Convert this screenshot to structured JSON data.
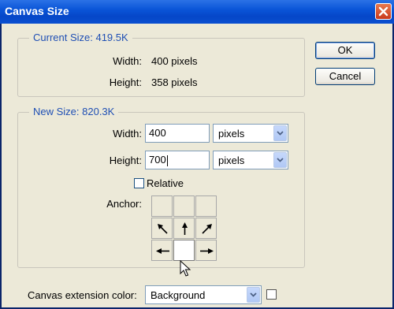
{
  "window": {
    "title": "Canvas Size"
  },
  "current_size": {
    "legend": "Current Size: 419.5K",
    "width_label": "Width:",
    "width_value": "400 pixels",
    "height_label": "Height:",
    "height_value": "358 pixels"
  },
  "new_size": {
    "legend": "New Size: 820.3K",
    "width_label": "Width:",
    "width_value": "400",
    "width_unit": "pixels",
    "height_label": "Height:",
    "height_value": "700",
    "height_unit": "pixels",
    "relative_label": "Relative",
    "relative_checked": false,
    "anchor_label": "Anchor:",
    "anchor_selected": "bottom-center"
  },
  "buttons": {
    "ok": "OK",
    "cancel": "Cancel"
  },
  "extension": {
    "label": "Canvas extension color:",
    "value": "Background"
  },
  "colors": {
    "legend_text": "#1f4fb4",
    "titlebar": "#0a55d8",
    "dialog_bg": "#ece9d8"
  }
}
